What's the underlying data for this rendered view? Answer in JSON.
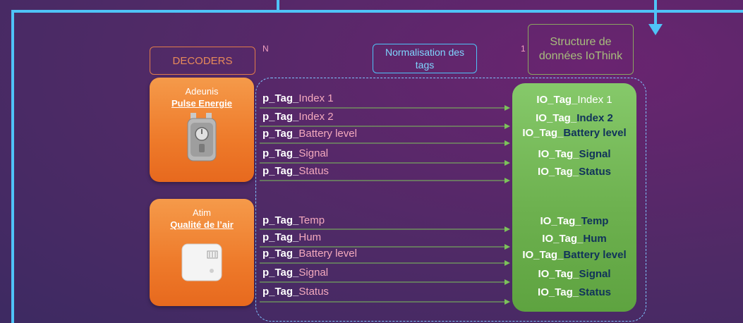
{
  "header": {
    "decoders_label": "DECODERS",
    "normalisation_label": "Normalisation des tags",
    "structure_label": "Structure de données IoThink",
    "multiplicity_n": "N",
    "multiplicity_1": "1"
  },
  "decoders": [
    {
      "vendor": "Adeunis",
      "model": "Pulse Energie",
      "tags": [
        {
          "prefix": "p_Tag_",
          "suffix": "Index 1"
        },
        {
          "prefix": "p_Tag_",
          "suffix": "Index 2"
        },
        {
          "prefix": "p_Tag_",
          "suffix": "Battery level"
        },
        {
          "prefix": "p_Tag_",
          "suffix": "Signal"
        },
        {
          "prefix": "p_Tag_",
          "suffix": "Status"
        }
      ]
    },
    {
      "vendor": "Atim",
      "model": "Qualité de l’air",
      "tags": [
        {
          "prefix": "p_Tag_",
          "suffix": "Temp"
        },
        {
          "prefix": "p_Tag_",
          "suffix": "Hum"
        },
        {
          "prefix": "p_Tag_",
          "suffix": "Battery level"
        },
        {
          "prefix": "p_Tag_",
          "suffix": "Signal"
        },
        {
          "prefix": "p_Tag_",
          "suffix": "Status"
        }
      ]
    }
  ],
  "iothink_tags": [
    {
      "prefix": "IO_Tag_",
      "suffix": "Index 1"
    },
    {
      "prefix": "IO_Tag_",
      "suffix": "Index 2"
    },
    {
      "prefix": "IO_Tag_",
      "suffix": "Battery level"
    },
    {
      "prefix": "IO_Tag_",
      "suffix": "Signal"
    },
    {
      "prefix": "IO_Tag_",
      "suffix": "Status"
    },
    {
      "prefix": "IO_Tag_",
      "suffix": "Temp"
    },
    {
      "prefix": "IO_Tag_",
      "suffix": "Hum"
    },
    {
      "prefix": "IO_Tag_",
      "suffix": "Battery level"
    },
    {
      "prefix": "IO_Tag_",
      "suffix": "Signal"
    },
    {
      "prefix": "IO_Tag_",
      "suffix": "Status"
    }
  ],
  "colors": {
    "frame": "#4fc3f7",
    "decoder_box": "#ee7a2a",
    "iothink_panel": "#6db14f",
    "arrow": "#7cc25a",
    "tag_suffix": "#f3a9bd",
    "io_suffix_dark": "#10325a"
  },
  "icons": [
    "pulse-energy-sensor-icon",
    "air-quality-sensor-icon",
    "flow-arrow-icon"
  ]
}
